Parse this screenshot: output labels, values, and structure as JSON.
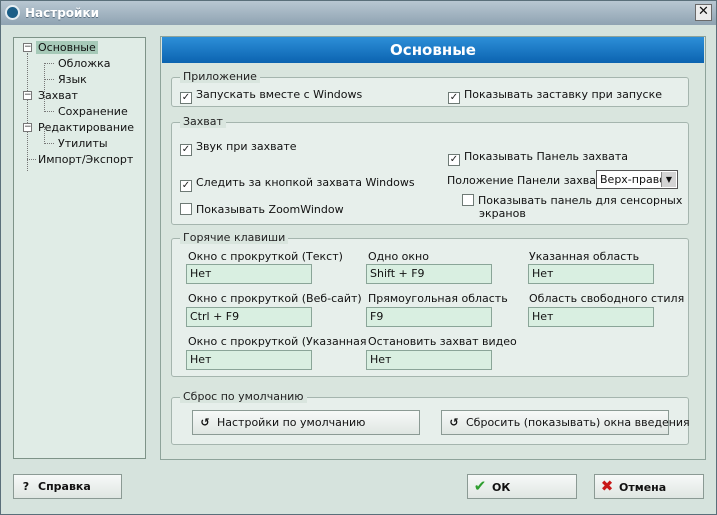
{
  "window": {
    "title": "Настройки",
    "close": "✕"
  },
  "tree": {
    "items": [
      {
        "label": "Основные"
      },
      {
        "label": "Обложка"
      },
      {
        "label": "Язык"
      },
      {
        "label": "Захват"
      },
      {
        "label": "Сохранение"
      },
      {
        "label": "Редактирование"
      },
      {
        "label": "Утилиты"
      },
      {
        "label": "Импорт/Экспорт"
      }
    ]
  },
  "main": {
    "title": "Основные"
  },
  "app_group": {
    "title": "Приложение",
    "run_with_windows": "Запускать вместе с Windows",
    "show_splash": "Показывать заставку при запуске"
  },
  "capture_group": {
    "title": "Захват",
    "sound": "Звук при захвате",
    "show_panel": "Показывать Панель захвата",
    "follow_key": "Следить за кнопкой захвата Windows",
    "panel_position_label": "Положение Панели захвата",
    "panel_position_value": "Верх-право",
    "zoom_window": "Показывать ZoomWindow",
    "touch_panel": "Показывать панель для сенсорных",
    "touch_panel_2": "экранов"
  },
  "hotkeys": {
    "title": "Горячие клавиши",
    "items": [
      {
        "label": "Окно с прокруткой (Текст)",
        "value": "Нет"
      },
      {
        "label": "Одно окно",
        "value": "Shift + F9"
      },
      {
        "label": "Указанная область",
        "value": "Нет"
      },
      {
        "label": "Окно с прокруткой (Веб-сайт)",
        "value": "Ctrl + F9"
      },
      {
        "label": "Прямоугольная область",
        "value": "F9"
      },
      {
        "label": "Область свободного стиля",
        "value": "Нет"
      },
      {
        "label": "Окно с прокруткой (Указанная",
        "value": "Нет"
      },
      {
        "label": "Остановить захват видео",
        "value": "Нет"
      }
    ]
  },
  "reset_group": {
    "title": "Сброс по умолчанию",
    "defaults_button": "Настройки по умолчанию",
    "reset_intro_button": "Сбросить (показывать) окна введения"
  },
  "footer": {
    "help": "Справка",
    "ok": "ОК",
    "cancel": "Отмена"
  },
  "colors": {
    "header": "#1f7cc8",
    "ok_icon": "#2e9e2e",
    "cancel_icon": "#c81818"
  }
}
